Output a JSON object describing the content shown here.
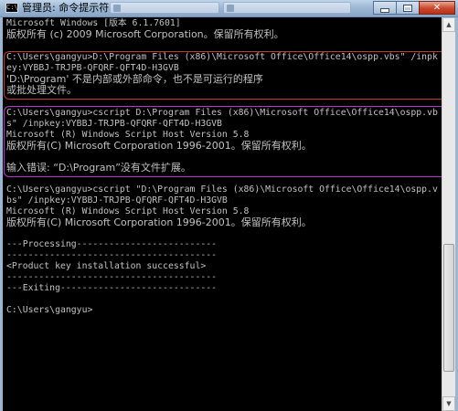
{
  "window": {
    "title": "管理员: 命令提示符",
    "background_tabs": [
      "",
      ""
    ],
    "controls": {
      "minimize": "minimize",
      "maximize": "maximize",
      "close": "✕"
    }
  },
  "console": {
    "lines": [
      "Microsoft Windows [版本 6.1.7601]",
      "版权所有 (c) 2009 Microsoft Corporation。保留所有权利。",
      "",
      "C:\\Users\\gangyu>D:\\Program Files (x86)\\Microsoft Office\\Office14\\ospp.vbs\" /inpk",
      "ey:VYBBJ-TRJPB-QFQRF-QFT4D-H3GVB",
      "'D:\\Program' 不是内部或外部命令，也不是可运行的程序",
      "或批处理文件。",
      "",
      "C:\\Users\\gangyu>cscript D:\\Program Files (x86)\\Microsoft Office\\Office14\\ospp.vb",
      "s\" /inpkey:VYBBJ-TRJPB-QFQRF-QFT4D-H3GVB",
      "Microsoft (R) Windows Script Host Version 5.8",
      "版权所有(C) Microsoft Corporation 1996-2001。保留所有权利。",
      "",
      "输入错误: “D:\\Program”没有文件扩展。",
      "",
      "C:\\Users\\gangyu>cscript \"D:\\Program Files (x86)\\Microsoft Office\\Office14\\ospp.v",
      "bs\" /inpkey:VYBBJ-TRJPB-QFQRF-QFT4D-H3GVB",
      "Microsoft (R) Windows Script Host Version 5.8",
      "版权所有(C) Microsoft Corporation 1996-2001。保留所有权利。",
      "",
      "---Processing--------------------------",
      "---------------------------------------",
      "<Product key installation successful>",
      "---------------------------------------",
      "---Exiting-----------------------------",
      "",
      "C:\\Users\\gangyu>"
    ]
  },
  "annotations": {
    "red_box_color": "#c0392b",
    "purple_box_color": "#b535c9"
  }
}
